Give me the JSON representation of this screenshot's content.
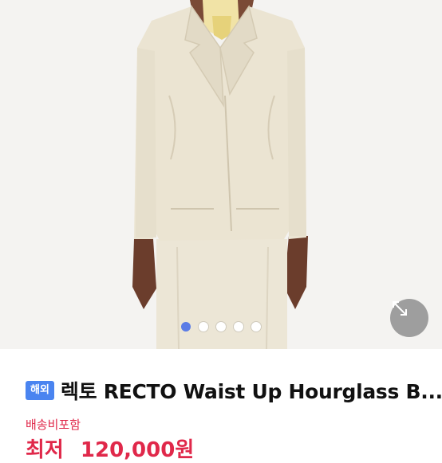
{
  "product": {
    "image_alt": "cream double-breasted hourglass blazer with skirt",
    "carousel": {
      "total": 5,
      "active_index": 0
    },
    "zoom_icon": "expand-arrows-icon",
    "badge": "해외",
    "title": "렉토 RECTO Waist Up Hourglass B...",
    "shipping": "배송비포함",
    "price_label": "최저",
    "price": "120,000원"
  },
  "colors": {
    "accent_blue": "#5b7ce6",
    "badge_blue": "#4a84f0",
    "price_red": "#e0284a"
  }
}
